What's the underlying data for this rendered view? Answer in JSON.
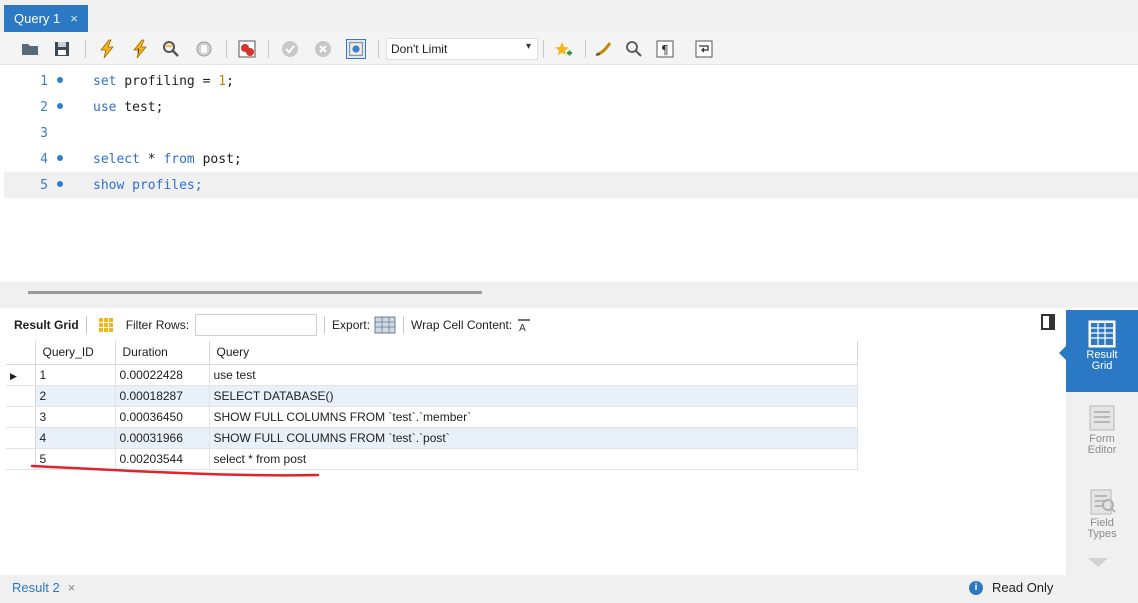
{
  "tabs": {
    "query_tab": "Query 1",
    "close": "×"
  },
  "toolbar": {
    "icons": [
      "folder-icon",
      "save-icon",
      "execute-icon",
      "execute-current-icon",
      "explain-icon",
      "stop-icon",
      "toggle-error-icon",
      "commit-icon",
      "rollback-icon",
      "autocommit-icon",
      "beautify-icon",
      "bookmark-icon",
      "find-icon",
      "invisible-chars-icon",
      "wrap-icon"
    ],
    "limit": "Don't Limit"
  },
  "editor": {
    "lines": [
      {
        "num": "1",
        "dot": true,
        "tokens": [
          {
            "t": "set",
            "c": "kw"
          },
          {
            "t": " profiling = ",
            "c": ""
          },
          {
            "t": "1",
            "c": "num"
          },
          {
            "t": ";",
            "c": ""
          }
        ]
      },
      {
        "num": "2",
        "dot": true,
        "tokens": [
          {
            "t": "use",
            "c": "kw"
          },
          {
            "t": " test;",
            "c": ""
          }
        ]
      },
      {
        "num": "3",
        "dot": false,
        "tokens": []
      },
      {
        "num": "4",
        "dot": true,
        "tokens": [
          {
            "t": "select",
            "c": "kw"
          },
          {
            "t": " * ",
            "c": ""
          },
          {
            "t": "from",
            "c": "kw"
          },
          {
            "t": " post;",
            "c": ""
          }
        ]
      },
      {
        "num": "5",
        "dot": true,
        "tokens": [
          {
            "t": "show profiles;",
            "c": "kw"
          }
        ]
      }
    ]
  },
  "result_toolbar": {
    "result_grid": "Result Grid",
    "filter_rows": "Filter Rows:",
    "export": "Export:",
    "wrap": "Wrap Cell Content:"
  },
  "grid": {
    "columns": [
      "Query_ID",
      "Duration",
      "Query"
    ],
    "rows": [
      [
        "1",
        "0.00022428",
        "use test"
      ],
      [
        "2",
        "0.00018287",
        "SELECT DATABASE()"
      ],
      [
        "3",
        "0.00036450",
        "SHOW FULL COLUMNS FROM `test`.`member`"
      ],
      [
        "4",
        "0.00031966",
        "SHOW FULL COLUMNS FROM `test`.`post`"
      ],
      [
        "5",
        "0.00203544",
        "select * from post"
      ]
    ]
  },
  "side_panel": {
    "result_grid": [
      "Result",
      "Grid"
    ],
    "form_editor": [
      "Form",
      "Editor"
    ],
    "field_types": [
      "Field",
      "Types"
    ]
  },
  "status": {
    "result_tab": "Result 2",
    "close": "×",
    "read_only": "Read Only",
    "info": "i"
  },
  "colors": {
    "accent": "#2b79c4",
    "alt_row": "#e8f0fa",
    "annotation": "#e0242a"
  }
}
